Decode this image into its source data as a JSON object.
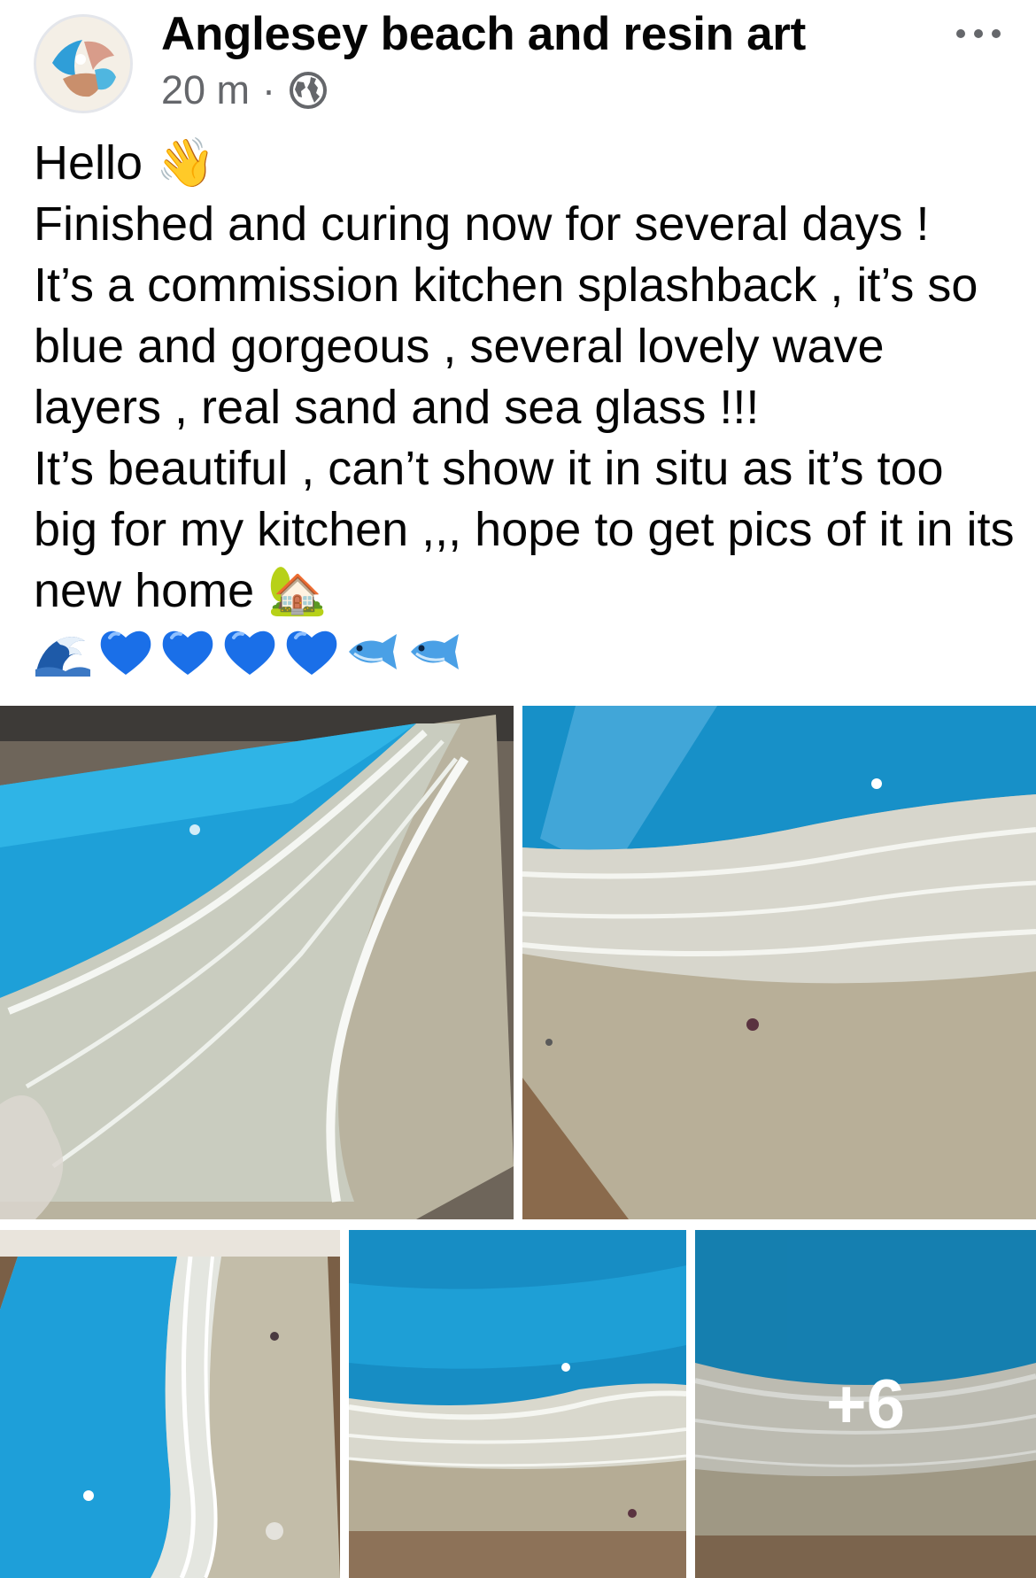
{
  "post": {
    "page_name": "Anglesey beach and resin art",
    "time": "20 m",
    "separator": "·",
    "audience_icon": "globe-icon",
    "menu_icon": "more-horizontal-icon",
    "text": "Hello 👋\nFinished and curing now for several days !\nIt’s a commission kitchen splashback , it’s so blue and gorgeous , several lovely wave layers , real sand and sea glass !!!\nIt’s beautiful , can’t show it in situ as it’s too big for my kitchen ,,, hope to get pics of it in its new home 🏡",
    "emoji_line": [
      "wave-emoji",
      "blue-heart-emoji",
      "blue-heart-emoji",
      "blue-heart-emoji",
      "blue-heart-emoji",
      "fish-emoji",
      "fish-emoji"
    ]
  },
  "gallery": {
    "photos": [
      {
        "name": "resin-splashback-photo-1"
      },
      {
        "name": "resin-splashback-photo-2"
      },
      {
        "name": "resin-splashback-photo-3"
      },
      {
        "name": "resin-splashback-photo-4"
      },
      {
        "name": "resin-splashback-photo-5"
      }
    ],
    "more_count": "+6"
  },
  "colors": {
    "text": "#050505",
    "secondary_text": "#65676b",
    "ocean": "#1f9fd6",
    "sand": "#b8b09a",
    "foam": "#eef2ef"
  }
}
